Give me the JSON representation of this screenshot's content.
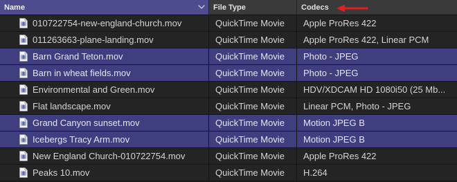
{
  "columns": {
    "name": "Name",
    "file_type": "File Type",
    "codecs": "Codecs"
  },
  "icons": {
    "sort": "sort-descending-chevron-icon",
    "annotation": "red-arrow-icon",
    "file": "movie-file-icon"
  },
  "colors": {
    "header_bg": "#3a3a3a",
    "header_selected_bg": "#4c4c8e",
    "row_bg": "#242424",
    "row_selected_bg": "#3f3f80",
    "annotation_arrow": "#e02020"
  },
  "rows": [
    {
      "name": "010722754-new-england-church.mov",
      "type": "QuickTime Movie",
      "codecs": "Apple ProRes 422",
      "selected": false
    },
    {
      "name": "011263663-plane-landing.mov",
      "type": "QuickTime Movie",
      "codecs": "Apple ProRes 422, Linear PCM",
      "selected": false
    },
    {
      "name": "Barn Grand Teton.mov",
      "type": "QuickTime Movie",
      "codecs": "Photo - JPEG",
      "selected": true
    },
    {
      "name": "Barn in wheat fields.mov",
      "type": "QuickTime Movie",
      "codecs": "Photo - JPEG",
      "selected": true
    },
    {
      "name": "Environmental and Green.mov",
      "type": "QuickTime Movie",
      "codecs": "HDV/XDCAM HD 1080i50 (25 Mb...",
      "selected": false
    },
    {
      "name": "Flat landscape.mov",
      "type": "QuickTime Movie",
      "codecs": "Linear PCM, Photo - JPEG",
      "selected": false
    },
    {
      "name": "Grand Canyon sunset.mov",
      "type": "QuickTime Movie",
      "codecs": "Motion JPEG B",
      "selected": true
    },
    {
      "name": "Icebergs Tracy Arm.mov",
      "type": "QuickTime Movie",
      "codecs": "Motion JPEG B",
      "selected": true
    },
    {
      "name": "New England Church-010722754.mov",
      "type": "QuickTime Movie",
      "codecs": "Apple ProRes 422",
      "selected": false
    },
    {
      "name": "Peaks 10.mov",
      "type": "QuickTime Movie",
      "codecs": "H.264",
      "selected": false
    }
  ]
}
